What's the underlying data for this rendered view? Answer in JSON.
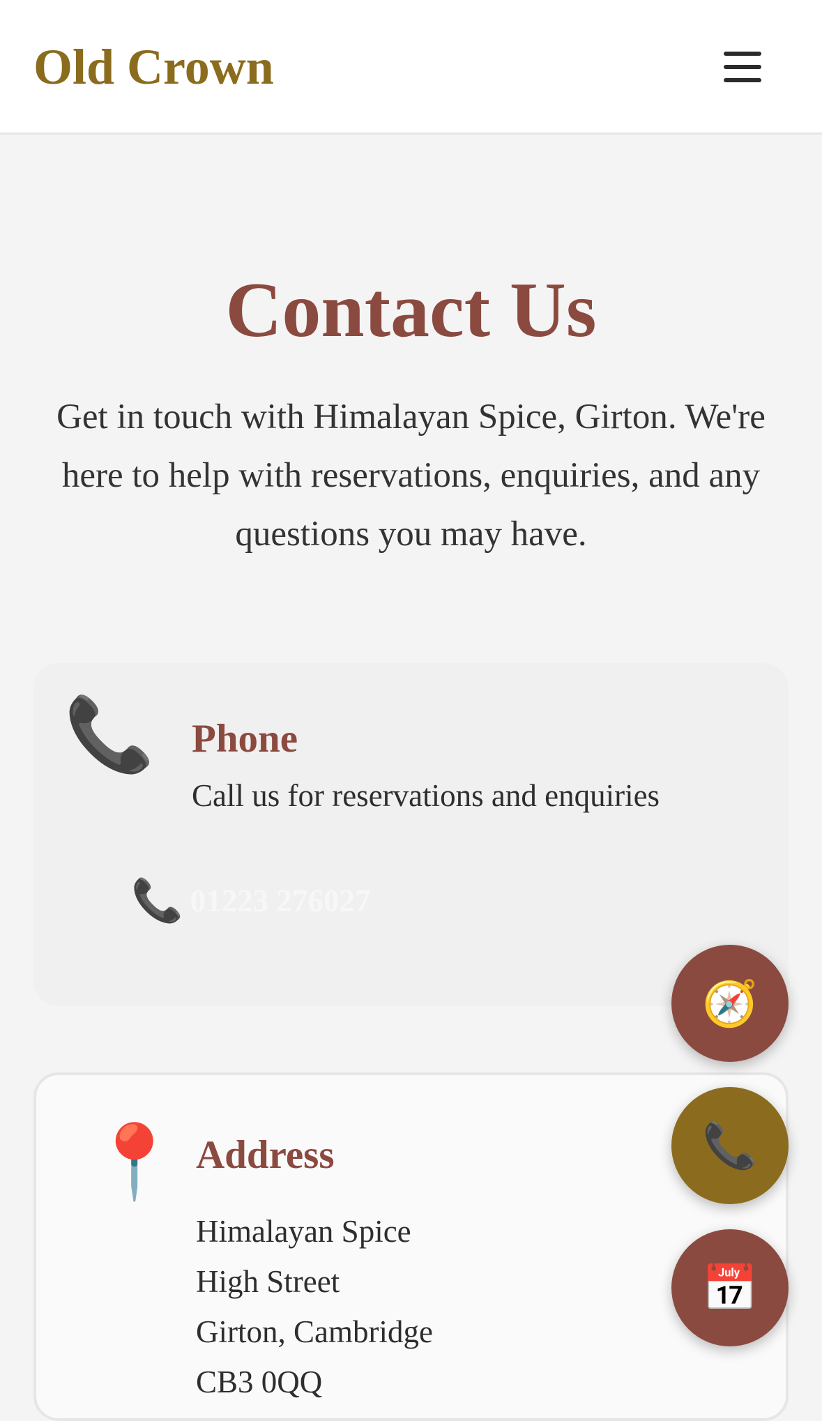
{
  "header": {
    "brand": "Old Crown",
    "menu_icon": "hamburger-menu-icon"
  },
  "hero": {
    "title": "Contact Us",
    "intro": "Get in touch with Himalayan Spice, Girton. We're here to help with reservations, enquiries, and any questions you may have."
  },
  "phone_card": {
    "icon": "📞",
    "title": "Phone",
    "description": "Call us for reservations and enquiries",
    "link_icon": "📞",
    "number": "01223 276027"
  },
  "address_card": {
    "icon": "📍",
    "title": "Address",
    "lines": [
      "Himalayan Spice",
      "High Street",
      "Girton, Cambridge",
      "CB3 0QQ"
    ]
  },
  "floating_actions": {
    "directions_icon": "🧭",
    "call_icon": "📞",
    "book_icon": "📅"
  },
  "colors": {
    "brand": "#8b6c1e",
    "accent": "#8b4a40",
    "background": "#f4f4f4"
  }
}
